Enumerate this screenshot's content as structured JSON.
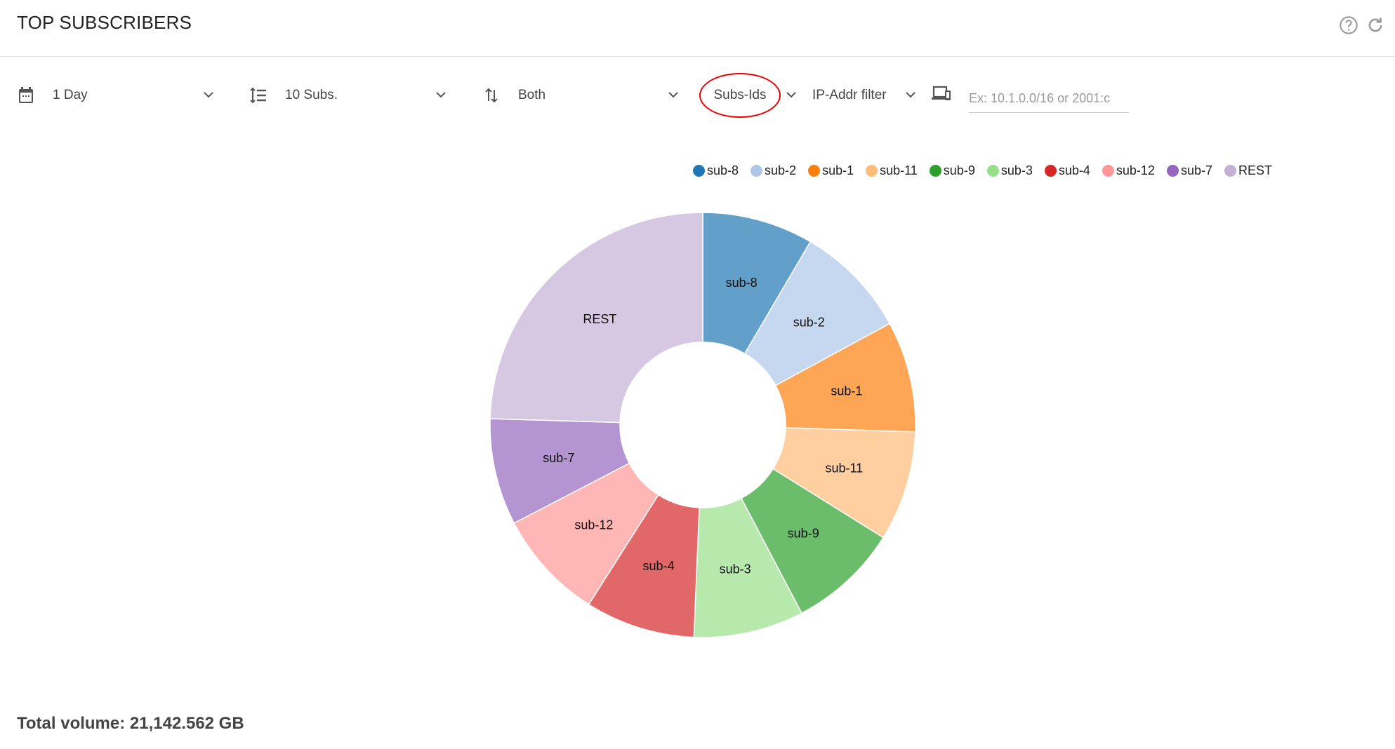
{
  "header": {
    "title": "TOP SUBSCRIBERS",
    "help_icon": "help-circle-icon",
    "refresh_icon": "refresh-icon"
  },
  "toolbar": {
    "period": {
      "icon": "calendar-icon",
      "value": "1 Day"
    },
    "count": {
      "icon": "sort-list-icon",
      "value": "10 Subs."
    },
    "direction": {
      "icon": "up-down-arrows-icon",
      "value": "Both"
    },
    "id_type": {
      "value": "Subs-Ids"
    },
    "ip_filter": {
      "value": "IP-Addr filter",
      "icon": "devices-icon"
    },
    "ip_input": {
      "placeholder": "Ex: 10.1.0.0/16 or 2001:c",
      "value": ""
    }
  },
  "chart_data": {
    "type": "pie",
    "donut": true,
    "unit": "GB",
    "legend_position": "top-right",
    "categories": [
      "sub-8",
      "sub-2",
      "sub-1",
      "sub-11",
      "sub-9",
      "sub-3",
      "sub-4",
      "sub-12",
      "sub-7",
      "REST"
    ],
    "values": [
      1785,
      1826,
      1785,
      1768,
      1780,
      1768,
      1762,
      1768,
      1715,
      5186
    ],
    "colors": [
      "#1f77b4",
      "#aec7e8",
      "#ff7f0e",
      "#ffbb78",
      "#2ca02c",
      "#98df8a",
      "#d62728",
      "#ff9896",
      "#9467bd",
      "#c5b0d5"
    ]
  },
  "footer": {
    "total_label": "Total volume: 21,142.562 GB"
  }
}
